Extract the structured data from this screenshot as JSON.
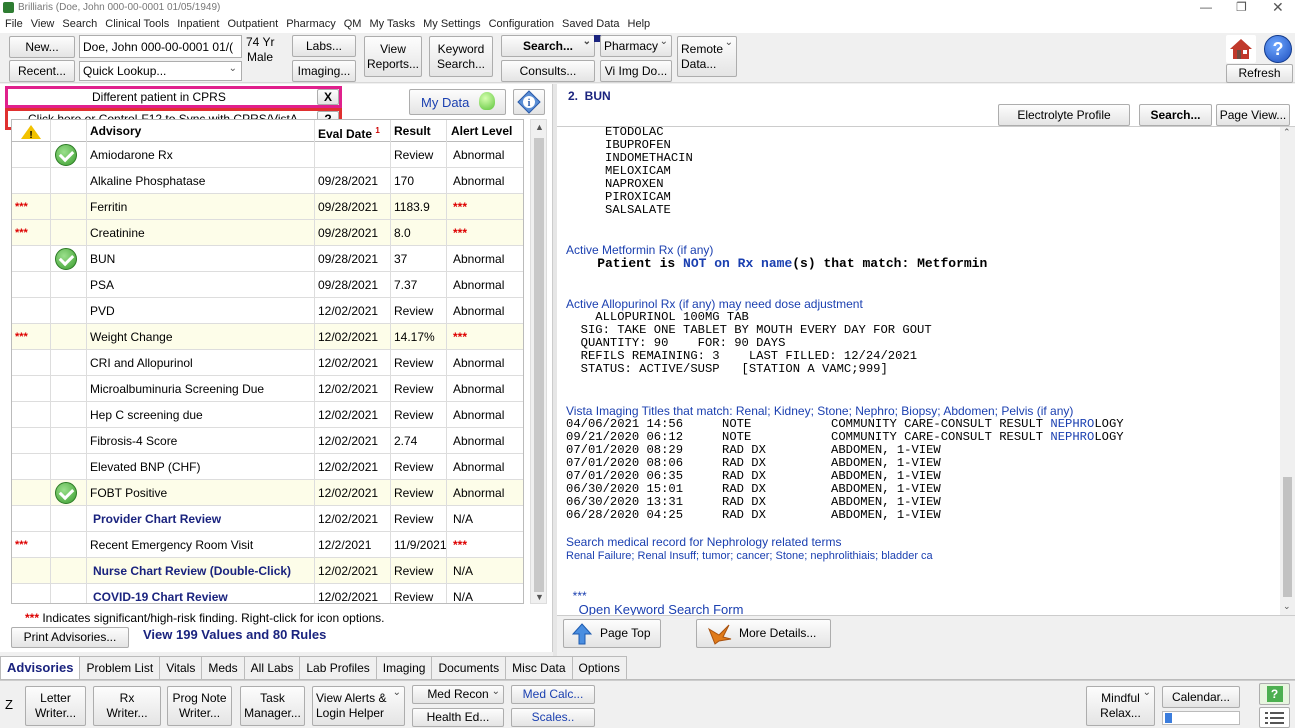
{
  "window": {
    "title": "Brilliaris (Doe, John  000-00-0001  01/05/1949)"
  },
  "menu": [
    "File",
    "View",
    "Search",
    "Clinical Tools",
    "Inpatient",
    "Outpatient",
    "Pharmacy",
    "QM",
    "My Tasks",
    "My Settings",
    "Configuration",
    "Saved Data",
    "Help"
  ],
  "toolbar": {
    "new": "New...",
    "recent": "Recent...",
    "patient_field": "Doe, John  000-00-0001  01/(",
    "quick_lookup": "Quick Lookup...",
    "age": "74 Yr",
    "sex": "Male",
    "labs": "Labs...",
    "imaging": "Imaging...",
    "view_reports_1": "View",
    "view_reports_2": "Reports...",
    "keyword_1": "Keyword",
    "keyword_2": "Search...",
    "search": "Search...",
    "consults": "Consults...",
    "pharmacy": "Pharmacy",
    "viimg": "Vi Img Do...",
    "remote_1": "Remote",
    "remote_2": "Data...",
    "refresh": "Refresh"
  },
  "banner": {
    "different": "Different patient in CPRS",
    "close": "X",
    "sync": "Click here or Control-F12 to Sync with CPRS/VistA",
    "help": "?"
  },
  "mydata": "My Data",
  "table": {
    "headers": {
      "advisory": "Advisory",
      "date": "Eval Date",
      "sort": "1",
      "result": "Result",
      "alert": "Alert Level"
    },
    "rows": [
      {
        "flag": "",
        "check": true,
        "name": "Amiodarone Rx",
        "date": "",
        "result": "Review",
        "alert": "Abnormal",
        "yellow": false,
        "bold": false
      },
      {
        "flag": "",
        "check": false,
        "name": "Alkaline Phosphatase",
        "date": "09/28/2021",
        "result": "170",
        "alert": "Abnormal",
        "yellow": false,
        "bold": false
      },
      {
        "flag": "***",
        "check": false,
        "name": "Ferritin",
        "date": "09/28/2021",
        "result": "1183.9",
        "alert": "***",
        "yellow": true,
        "bold": false
      },
      {
        "flag": "***",
        "check": false,
        "name": "Creatinine",
        "date": "09/28/2021",
        "result": "8.0",
        "alert": "***",
        "yellow": true,
        "bold": false
      },
      {
        "flag": "",
        "check": true,
        "name": "BUN",
        "date": "09/28/2021",
        "result": "37",
        "alert": "Abnormal",
        "yellow": false,
        "bold": false
      },
      {
        "flag": "",
        "check": false,
        "name": "PSA",
        "date": "09/28/2021",
        "result": "7.37",
        "alert": "Abnormal",
        "yellow": false,
        "bold": false
      },
      {
        "flag": "",
        "check": false,
        "name": "PVD",
        "date": "12/02/2021",
        "result": "Review",
        "alert": "Abnormal",
        "yellow": false,
        "bold": false
      },
      {
        "flag": "***",
        "check": false,
        "name": "Weight Change",
        "date": "12/02/2021",
        "result": "14.17%",
        "alert": "***",
        "yellow": true,
        "bold": false
      },
      {
        "flag": "",
        "check": false,
        "name": "CRI and Allopurinol",
        "date": "12/02/2021",
        "result": "Review",
        "alert": "Abnormal",
        "yellow": false,
        "bold": false
      },
      {
        "flag": "",
        "check": false,
        "name": "Microalbuminuria Screening Due",
        "date": "12/02/2021",
        "result": "Review",
        "alert": "Abnormal",
        "yellow": false,
        "bold": false
      },
      {
        "flag": "",
        "check": false,
        "name": "Hep C screening due",
        "date": "12/02/2021",
        "result": "Review",
        "alert": "Abnormal",
        "yellow": false,
        "bold": false
      },
      {
        "flag": "",
        "check": false,
        "name": "Fibrosis-4 Score",
        "date": "12/02/2021",
        "result": "2.74",
        "alert": "Abnormal",
        "yellow": false,
        "bold": false
      },
      {
        "flag": "",
        "check": false,
        "name": "Elevated BNP (CHF)",
        "date": "12/02/2021",
        "result": "Review",
        "alert": "Abnormal",
        "yellow": false,
        "bold": false
      },
      {
        "flag": "",
        "check": true,
        "name": "FOBT Positive",
        "date": "12/02/2021",
        "result": "Review",
        "alert": "Abnormal",
        "yellow": true,
        "bold": false
      },
      {
        "flag": "",
        "check": false,
        "name": "Provider Chart Review",
        "date": "12/02/2021",
        "result": "Review",
        "alert": "N/A",
        "yellow": false,
        "bold": true
      },
      {
        "flag": "***",
        "check": false,
        "name": "Recent Emergency Room Visit",
        "date": "12/2/2021",
        "result": "11/9/2021",
        "alert": "***",
        "yellow": false,
        "bold": false
      },
      {
        "flag": "",
        "check": false,
        "name": "Nurse Chart Review (Double-Click)",
        "date": "12/02/2021",
        "result": "Review",
        "alert": "N/A",
        "yellow": true,
        "bold": true
      },
      {
        "flag": "",
        "check": false,
        "name": "COVID-19 Chart Review",
        "date": "12/02/2021",
        "result": "Review",
        "alert": "N/A",
        "yellow": false,
        "bold": true
      }
    ]
  },
  "footer_note": {
    "stars": "***",
    "text": " Indicates significant/high-risk finding. Right-click for icon options."
  },
  "print_advisories": "Print Advisories...",
  "view_values": "View 199 Values and 80 Rules",
  "right": {
    "heading": "2.  BUN",
    "electrolyte": "Electrolyte Profile",
    "search": "Search...",
    "page_view": "Page View...",
    "drugs": [
      "ETODOLAC",
      "IBUPROFEN",
      "INDOMETHACIN",
      "MELOXICAM",
      "NAPROXEN",
      "PIROXICAM",
      "SALSALATE"
    ],
    "metformin_title": "Active Metformin Rx (if any)",
    "metformin_a": "    Patient is ",
    "metformin_b": "NOT on Rx name",
    "metformin_c": "(s) that match: Metformin",
    "allo_title": "Active Allopurinol Rx (if any) may need dose adjustment",
    "allo_lines": [
      "    ALLOPURINOL 100MG TAB",
      "  SIG: TAKE ONE TABLET BY MOUTH EVERY DAY FOR GOUT",
      "  QUANTITY: 90    FOR: 90 DAYS",
      "  REFILS REMAINING: 3    LAST FILLED: 12/24/2021",
      "  STATUS: ACTIVE/SUSP   [STATION A VAMC;999]"
    ],
    "vista_title": "Vista Imaging Titles that match: Renal; Kidney; Stone; Nephro; Biopsy; Abdomen; Pelvis (if any)",
    "vista_lines": [
      {
        "dt": "04/06/2021 14:56",
        "type": "NOTE",
        "desc_a": "COMMUNITY CARE-CONSULT RESULT ",
        "desc_b": "NEPHRO",
        "desc_c": "LOGY"
      },
      {
        "dt": "09/21/2020 06:12",
        "type": "NOTE",
        "desc_a": "COMMUNITY CARE-CONSULT RESULT ",
        "desc_b": "NEPHRO",
        "desc_c": "LOGY"
      },
      {
        "dt": "07/01/2020 08:29",
        "type": "RAD DX",
        "desc_a": "ABDOMEN, 1-VIEW",
        "desc_b": "",
        "desc_c": ""
      },
      {
        "dt": "07/01/2020 08:06",
        "type": "RAD DX",
        "desc_a": "ABDOMEN, 1-VIEW",
        "desc_b": "",
        "desc_c": ""
      },
      {
        "dt": "07/01/2020 06:35",
        "type": "RAD DX",
        "desc_a": "ABDOMEN, 1-VIEW",
        "desc_b": "",
        "desc_c": ""
      },
      {
        "dt": "06/30/2020 15:01",
        "type": "RAD DX",
        "desc_a": "ABDOMEN, 1-VIEW",
        "desc_b": "",
        "desc_c": ""
      },
      {
        "dt": "06/30/2020 13:31",
        "type": "RAD DX",
        "desc_a": "ABDOMEN, 1-VIEW",
        "desc_b": "",
        "desc_c": ""
      },
      {
        "dt": "06/28/2020 04:25",
        "type": "RAD DX",
        "desc_a": "ABDOMEN, 1-VIEW",
        "desc_b": "",
        "desc_c": ""
      }
    ],
    "search_title": "Search medical record for Nephrology related terms",
    "search_terms": "Renal Failure; Renal Insuff; tumor; cancer; Stone; nephrolithiais; bladder ca",
    "stars": "***",
    "open_keyword": "Open Keyword Search Form",
    "page_top": "Page Top",
    "more_details": "More Details..."
  },
  "tabs": [
    "Advisories",
    "Problem List",
    "Vitals",
    "Meds",
    "All Labs",
    "Lab Profiles",
    "Imaging",
    "Documents",
    "Misc Data",
    "Options"
  ],
  "bottom": {
    "z": "Z",
    "letter_1": "Letter",
    "letter_2": "Writer...",
    "rx_1": "Rx",
    "rx_2": "Writer...",
    "prog_1": "Prog Note",
    "prog_2": "Writer...",
    "task_1": "Task",
    "task_2": "Manager...",
    "alerts_1": "View Alerts &",
    "alerts_2": "Login Helper",
    "medrecon": "Med Recon",
    "healthed": "Health Ed...",
    "medcalc": "Med Calc...",
    "scales": "Scales..",
    "mindful_1": "Mindful",
    "mindful_2": "Relax...",
    "calendar": "Calendar..."
  },
  "colors": {
    "accent_blue": "#1a3fb0",
    "alert_red": "#d00000",
    "banner_border": "#e0208c",
    "sync_border": "#e03030",
    "yellow_row": "#fdfde9"
  }
}
